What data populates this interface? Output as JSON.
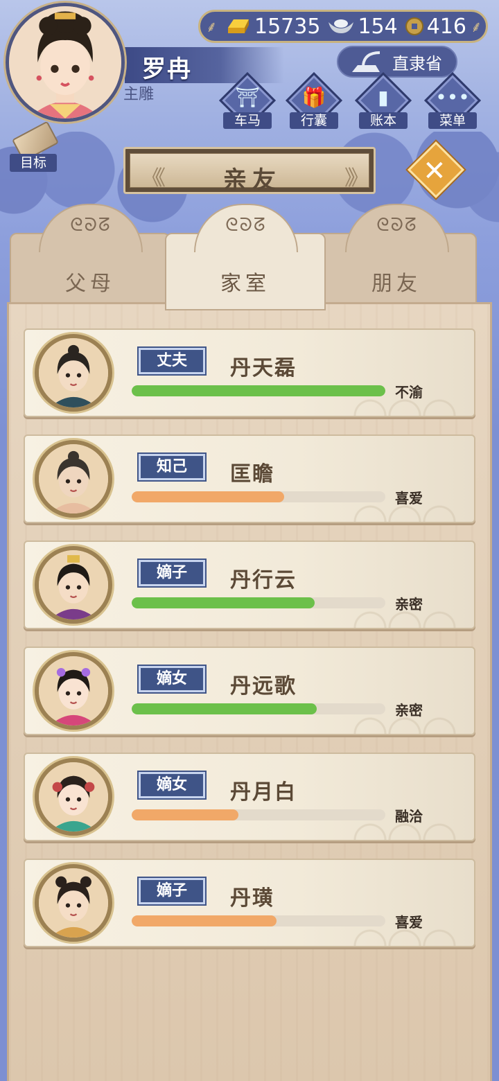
{
  "player": {
    "name": "罗冉",
    "title": "主雕"
  },
  "currency": {
    "gold": "15735",
    "silver": "154",
    "copper": "416"
  },
  "province": "直隶省",
  "menu": [
    {
      "label": "车马",
      "icon": "carriage-icon"
    },
    {
      "label": "行囊",
      "icon": "bundle-icon"
    },
    {
      "label": "账本",
      "icon": "ledger-icon"
    },
    {
      "label": "菜单",
      "icon": "more-icon"
    }
  ],
  "goal_label": "目标",
  "page_title": "亲友",
  "tabs": [
    {
      "label": "父母",
      "active": false
    },
    {
      "label": "家室",
      "active": true
    },
    {
      "label": "朋友",
      "active": false
    }
  ],
  "members": [
    {
      "relation": "丈夫",
      "name": "丹天磊",
      "status": "不渝",
      "affection": 1.0,
      "bar_color": "#6cc04a"
    },
    {
      "relation": "知己",
      "name": "匡瞻",
      "status": "喜爱",
      "affection": 0.6,
      "bar_color": "#f1a868"
    },
    {
      "relation": "嫡子",
      "name": "丹行云",
      "status": "亲密",
      "affection": 0.72,
      "bar_color": "#6cc04a"
    },
    {
      "relation": "嫡女",
      "name": "丹远歌",
      "status": "亲密",
      "affection": 0.73,
      "bar_color": "#6cc04a"
    },
    {
      "relation": "嫡女",
      "name": "丹月白",
      "status": "融洽",
      "affection": 0.42,
      "bar_color": "#f1a868"
    },
    {
      "relation": "嫡子",
      "name": "丹璜",
      "status": "喜爱",
      "affection": 0.57,
      "bar_color": "#f1a868"
    }
  ]
}
